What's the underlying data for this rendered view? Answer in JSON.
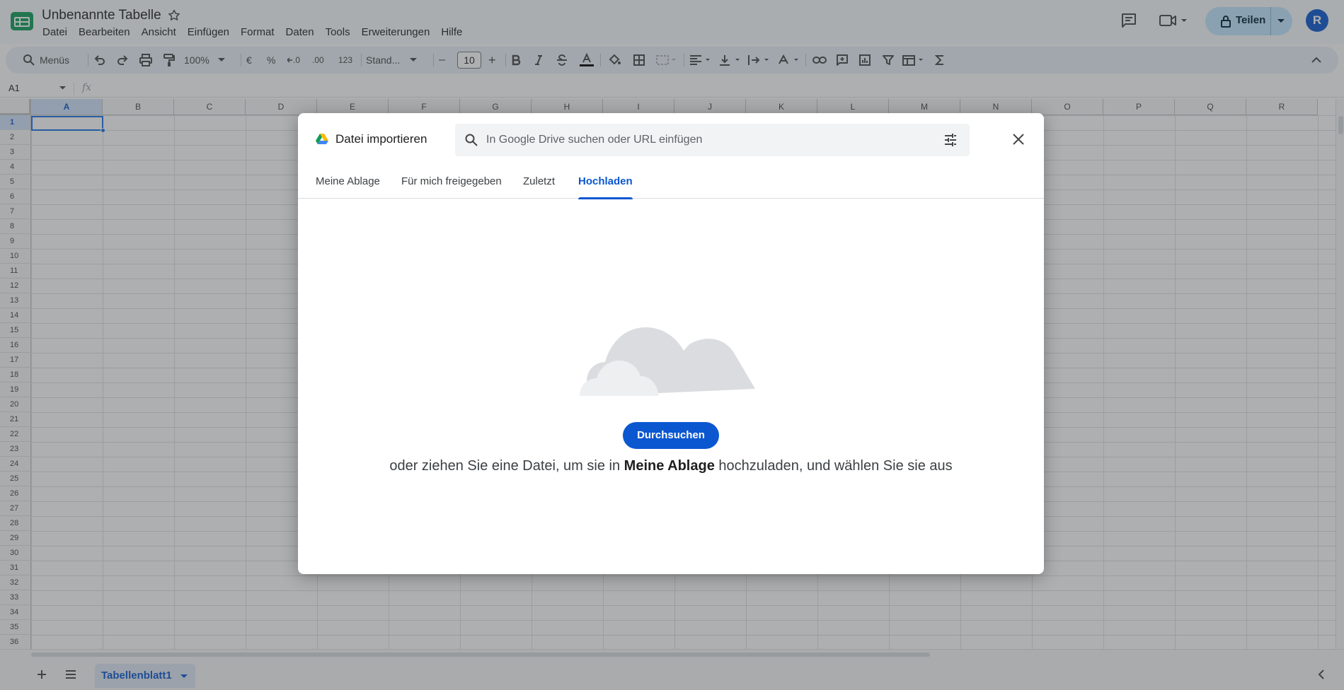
{
  "doc": {
    "title": "Unbenannte Tabelle"
  },
  "menu": [
    "Datei",
    "Bearbeiten",
    "Ansicht",
    "Einfügen",
    "Format",
    "Daten",
    "Tools",
    "Erweiterungen",
    "Hilfe"
  ],
  "header": {
    "share_label": "Teilen",
    "avatar_letter": "R"
  },
  "toolbar": {
    "menus_search": "Menüs",
    "zoom": "100%",
    "currency": "€",
    "percent": "%",
    "dec_decrease": ".0",
    "dec_increase": ".00",
    "number_format": "123",
    "font": "Stand...",
    "font_size": "10",
    "minus": "–",
    "plus": "+"
  },
  "formula_bar": {
    "name_box": "A1",
    "fx": "fx"
  },
  "grid": {
    "columns": [
      "A",
      "B",
      "C",
      "D",
      "E",
      "F",
      "G",
      "H",
      "I",
      "J",
      "K",
      "L",
      "M",
      "N",
      "O",
      "P",
      "Q",
      "R"
    ],
    "rows": [
      "1",
      "2",
      "3",
      "4",
      "5",
      "6",
      "7",
      "8",
      "9",
      "10",
      "11",
      "12",
      "13",
      "14",
      "15",
      "16",
      "17",
      "18",
      "19",
      "20",
      "21",
      "22",
      "23",
      "24",
      "25",
      "26",
      "27",
      "28",
      "29",
      "30",
      "31",
      "32",
      "33",
      "34",
      "35",
      "36"
    ],
    "selected_cell": "A1"
  },
  "sheets": {
    "tabs": [
      "Tabellenblatt1"
    ]
  },
  "dialog": {
    "title": "Datei importieren",
    "search_placeholder": "In Google Drive suchen oder URL einfügen",
    "tabs": [
      "Meine Ablage",
      "Für mich freigegeben",
      "Zuletzt",
      "Hochladen"
    ],
    "active_tab": "Hochladen",
    "browse_label": "Durchsuchen",
    "hint_before": "oder ziehen Sie eine Datei, um sie in ",
    "hint_bold": "Meine Ablage",
    "hint_after": " hochzuladen, und wählen Sie sie aus"
  },
  "colors": {
    "accent": "#0b57d0",
    "share_bg": "#c2e7ff",
    "overlay": "#3c4043"
  }
}
